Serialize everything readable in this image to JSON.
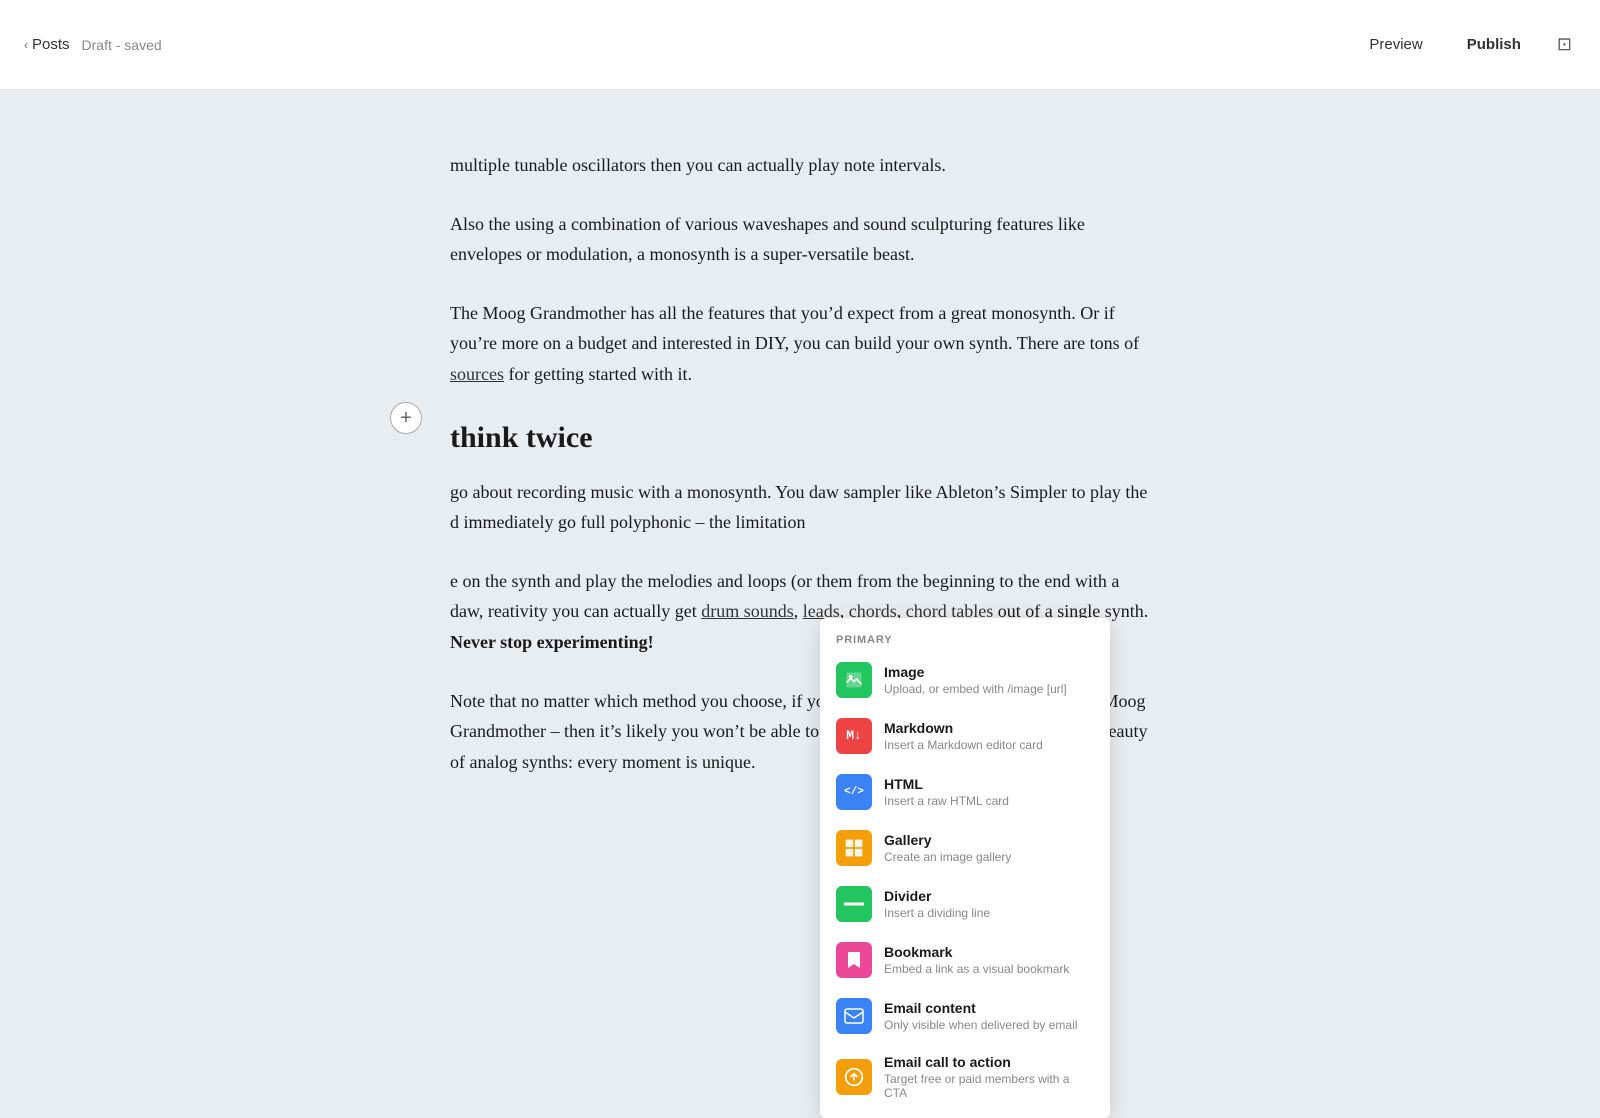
{
  "topbar": {
    "back_icon": "‹",
    "posts_label": "Posts",
    "draft_status": "Draft - saved",
    "preview_label": "Preview",
    "publish_label": "Publish",
    "layout_icon": "⊡"
  },
  "content": {
    "paragraph1": "multiple tunable oscillators then you can actually play note intervals.",
    "paragraph2": "Also the using a combination of various waveshapes and sound sculpturing features like envelopes or modulation, a monosynth is a super-versatile beast.",
    "paragraph3_start": "The Moog Grandmother has all the features that you’d expect from a great monosynth. Or if you’re more on a budget and interested in DIY, you can build your own synth. There are tons of ",
    "paragraph3_link": "sources",
    "paragraph3_end": " for getting started with it.",
    "heading_partial": "hink twice",
    "paragraph4_start": "go about recording music with a monosynth. You daw sampler like Ableton’s Simpler to play the d immediately go full polyphonic – the limitation",
    "paragraph5_start": "e on the synth and play the melodies and loops (or them from the beginning to the end with a daw, reativity you can actually get ",
    "paragraph5_link1": "drum sounds",
    "paragraph5_comma": ", ",
    "paragraph5_link2": "leads",
    "paragraph5_text2": ",",
    "paragraph5_link3": "chords",
    "paragraph5_and": ", ",
    "paragraph5_link4": "chord tables",
    "paragraph5_end": " out of a single synth. ",
    "paragraph5_bold": "Never stop experimenting!",
    "paragraph6": "Note that no matter which method you choose, if you synth doesn’t have presets – e.g. the Moog Grandmother – then it’s likely you won’t be able to re-load the same sound. But that’s the beauty of analog synths: every moment is unique."
  },
  "dropdown": {
    "header": "PRIMARY",
    "items": [
      {
        "id": "image",
        "icon": "🖼",
        "icon_class": "icon-image",
        "title": "Image",
        "description": "Upload, or embed with /image [url]"
      },
      {
        "id": "markdown",
        "icon": "M↓",
        "icon_class": "icon-markdown",
        "title": "Markdown",
        "description": "Insert a Markdown editor card"
      },
      {
        "id": "html",
        "icon": "</>",
        "icon_class": "icon-html",
        "title": "HTML",
        "description": "Insert a raw HTML card"
      },
      {
        "id": "gallery",
        "icon": "⊞",
        "icon_class": "icon-gallery",
        "title": "Gallery",
        "description": "Create an image gallery"
      },
      {
        "id": "divider",
        "icon": "≡",
        "icon_class": "icon-divider",
        "title": "Divider",
        "description": "Insert a dividing line"
      },
      {
        "id": "bookmark",
        "icon": "🔖",
        "icon_class": "icon-bookmark",
        "title": "Bookmark",
        "description": "Embed a link as a visual bookmark"
      },
      {
        "id": "email-content",
        "icon": "✉",
        "icon_class": "icon-email-content",
        "title": "Email content",
        "description": "Only visible when delivered by email"
      },
      {
        "id": "email-cta",
        "icon": "📢",
        "icon_class": "icon-email-cta",
        "title": "Email call to action",
        "description": "Target free or paid members with a CTA"
      }
    ]
  },
  "plus_button": "+"
}
